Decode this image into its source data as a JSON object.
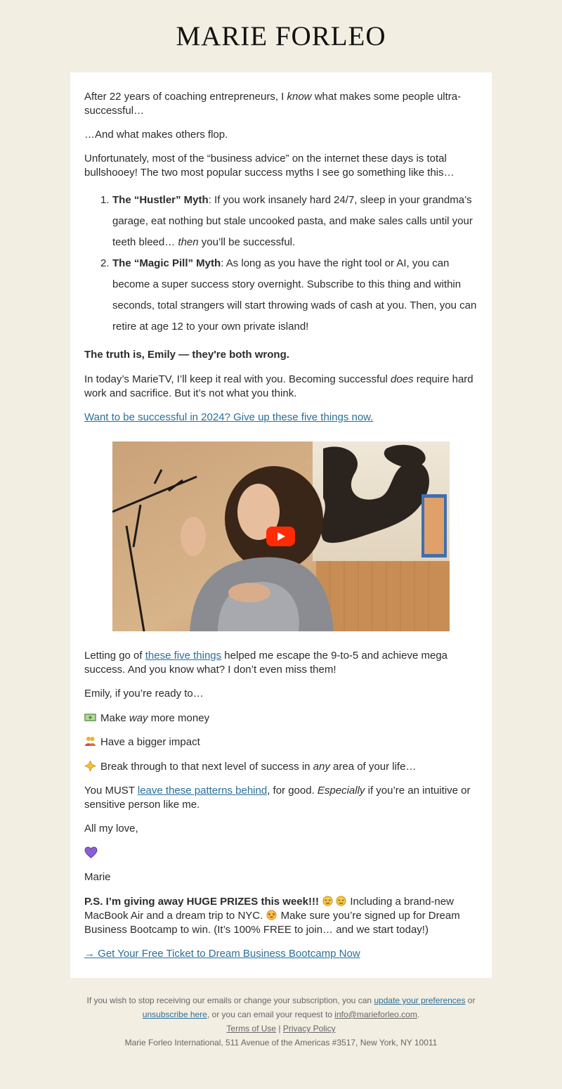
{
  "brand": {
    "logo": "MARIE FORLEO"
  },
  "email": {
    "p1_a": "After 22 years of coaching entrepreneurs, I ",
    "p1_em": "know",
    "p1_b": " what makes some people ultra-successful…",
    "p2": "…And what makes others flop.",
    "p3": "Unfortunately, most of the “business advice” on the internet these days is total bullshooey! The two most popular success myths I see go something like this…",
    "myths": [
      {
        "num": "1.",
        "title": "The “Hustler” Myth",
        "text_a": ": If you work insanely hard 24/7, sleep in your grandma’s garage, eat nothing but stale uncooked pasta, and make sales calls until your teeth bleed… ",
        "em": "then",
        "text_b": " you’ll be successful."
      },
      {
        "num": "2.",
        "title": "The “Magic Pill” Myth",
        "text": ": As long as you have the right tool or AI, you can become a super success story overnight. Subscribe to this thing and within seconds, total strangers will start throwing wads of cash at you. Then, you can retire at age 12 to your own private island!"
      }
    ],
    "truth": "The truth is, Emily — they're both wrong.",
    "p4_a": "In today’s MarieTV, I’ll keep it real with you. Becoming successful ",
    "p4_em": "does",
    "p4_b": " require hard work and sacrifice. But it’s not what you think.",
    "link1": "Want to be successful in 2024? Give up these five things now.",
    "p5_a": "Letting go of ",
    "p5_link": "these five things",
    "p5_b": " helped me escape the 9-to-5 and achieve mega success. And you know what? I don’t even miss them!",
    "p6": "Emily, if you’re ready to…",
    "b1_a": "Make ",
    "b1_em": "way",
    "b1_b": " more money",
    "b2": "Have a bigger impact",
    "b3_a": "Break through to that next level of success in ",
    "b3_em": "any",
    "b3_b": " area of your life…",
    "p7_a": "You MUST ",
    "p7_link": "leave these patterns behind",
    "p7_b": ", for good. ",
    "p7_em": "Especially",
    "p7_c": " if you’re an intuitive or sensitive person like me.",
    "signoff": "All my love,",
    "signature": "Marie",
    "ps_bold": "P.S. I’m giving away HUGE PRIZES this week!!!",
    "ps_a": " Including a brand-new MacBook Air and a dream trip to NYC. ",
    "ps_b": " Make sure you’re signed up for Dream Business Bootcamp to win. (It’s 100% FREE to join… and we start today!)",
    "cta": "→ Get Your Free Ticket to Dream Business Bootcamp Now"
  },
  "footer": {
    "l1_a": "If you wish to stop receiving our emails or change your subscription, you can ",
    "prefs_link": "update your preferences",
    "l1_b": " or",
    "unsub_link": "unsubscribe here",
    "l2_a": ", or you can email your request to ",
    "email_link": "info@marieforleo.com",
    "l2_b": ".",
    "terms": "Terms of Use",
    "sep": " | ",
    "privacy": "Privacy Policy",
    "address": "Marie Forleo International, 511 Avenue of the Americas #3517, New York, NY 10011"
  },
  "colors": {
    "background": "#f3eee2",
    "card": "#ffffff",
    "link": "#2a6f9a",
    "play_button": "#ff2b06"
  },
  "icons": [
    "money-icon",
    "people-icon",
    "sparkle-icon",
    "purple-heart-icon",
    "hot-face-icon",
    "star-struck-icon",
    "play-icon"
  ]
}
